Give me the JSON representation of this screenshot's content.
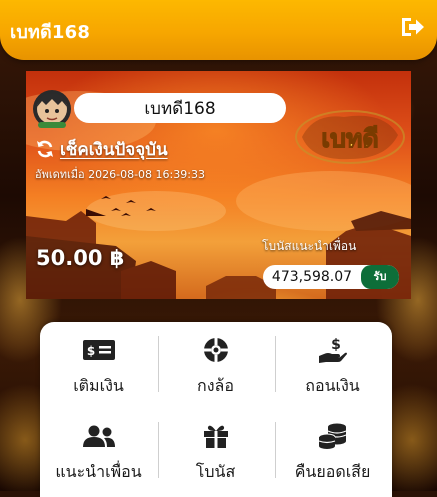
{
  "header": {
    "title": "เบทดี168",
    "logout_icon": "logout-icon",
    "background": "#f7a600"
  },
  "banner": {
    "username": "เบทดี168",
    "refresh_label": "เช็คเงินปัจจุบัน",
    "updated_text": "อัพเดทเมื่อ 2026-08-08 16:39:33",
    "brand_logo_text": "เบทดี",
    "balance": "50.00 ฿",
    "referral_label": "โบนัสแนะนำเพื่อน",
    "referral_amount": "473,598.07",
    "claim_label": "รับ",
    "claim_color": "#0d6e39"
  },
  "menu": {
    "items": [
      {
        "label": "เติมเงิน",
        "icon": "money-bill-icon"
      },
      {
        "label": "กงล้อ",
        "icon": "wheel-icon"
      },
      {
        "label": "ถอนเงิน",
        "icon": "hand-dollar-icon"
      },
      {
        "label": "แนะนำเพื่อน",
        "icon": "users-icon"
      },
      {
        "label": "โบนัส",
        "icon": "gift-icon"
      },
      {
        "label": "คืนยอดเสีย",
        "icon": "coins-icon"
      }
    ]
  }
}
